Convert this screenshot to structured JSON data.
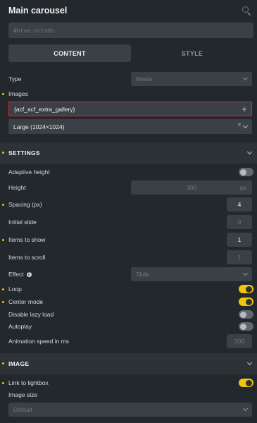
{
  "header": {
    "title": "Main carousel",
    "search_icon": "search-icon"
  },
  "element_id": {
    "value": "#brxe-octzdo"
  },
  "tabs": [
    {
      "label": "CONTENT",
      "active": true
    },
    {
      "label": "STYLE",
      "active": false
    }
  ],
  "type": {
    "label": "Type",
    "value": "Media"
  },
  "images": {
    "label": "Images",
    "dynamic_value": "{acf_acf_extra_gallery}",
    "size_value": "Large (1024×1024)",
    "clear_glyph": "×"
  },
  "settings": {
    "title": "SETTINGS",
    "adaptive_height": {
      "label": "Adaptive height",
      "on": false
    },
    "height": {
      "label": "Height",
      "value": "300",
      "unit": "px"
    },
    "spacing": {
      "label": "Spacing (px)",
      "value": "4"
    },
    "initial_slide": {
      "label": "Initial slide",
      "value": "0"
    },
    "items_to_show": {
      "label": "Items to show",
      "value": "1"
    },
    "items_to_scroll": {
      "label": "Items to scroll",
      "value": "1"
    },
    "effect": {
      "label": "Effect",
      "value": "Slide",
      "info": "i"
    },
    "loop": {
      "label": "Loop",
      "on": true
    },
    "center_mode": {
      "label": "Center mode",
      "on": true
    },
    "disable_lazy_load": {
      "label": "Disable lazy load",
      "on": false
    },
    "autoplay": {
      "label": "Autoplay",
      "on": false
    },
    "animation_speed": {
      "label": "Animation speed in ms",
      "value": "300"
    }
  },
  "image": {
    "title": "IMAGE",
    "link_to_lightbox": {
      "label": "Link to lightbox",
      "on": true
    },
    "image_size": {
      "label": "Image size",
      "value": "Default"
    }
  },
  "colors": {
    "accent": "#f1c40f",
    "highlight_border": "#d62d2d",
    "background": "#23282d",
    "field": "#3a4046"
  }
}
